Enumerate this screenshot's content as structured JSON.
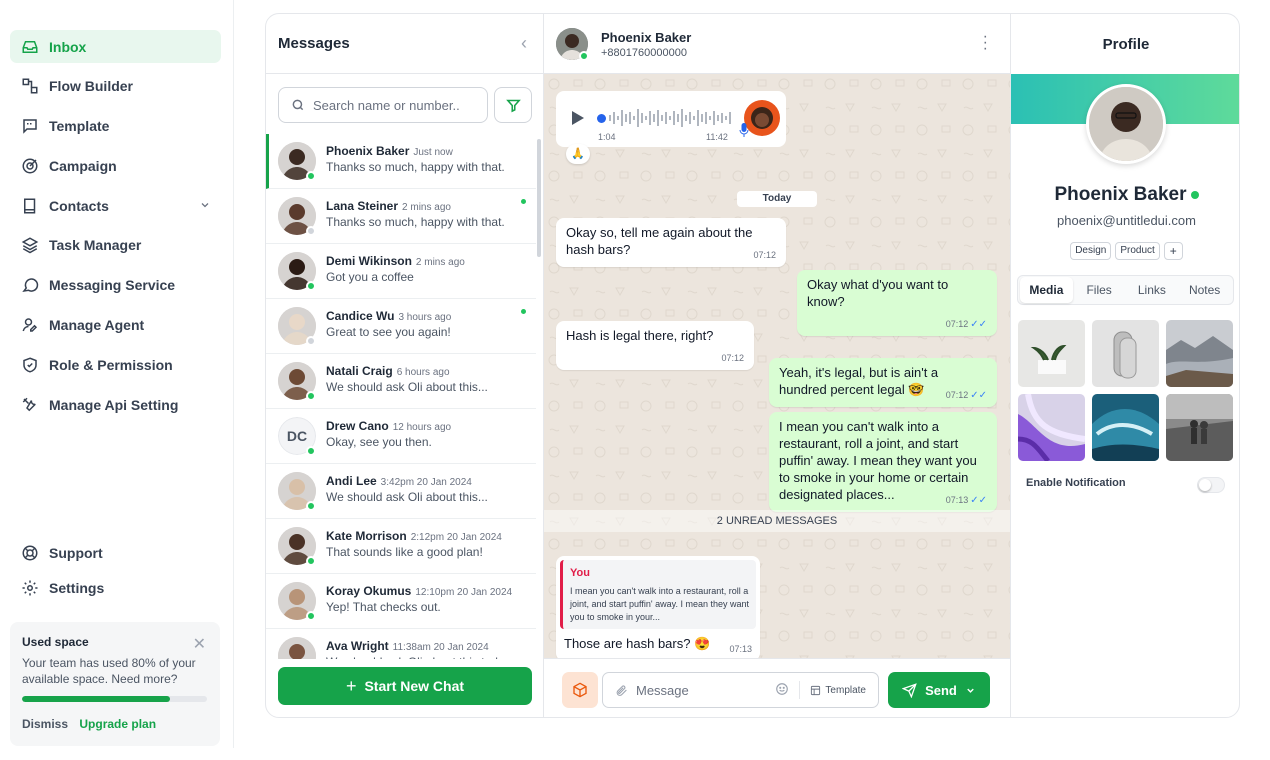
{
  "nav": {
    "items": [
      {
        "label": "Inbox",
        "icon": "inbox-icon",
        "active": true
      },
      {
        "label": "Flow Builder",
        "icon": "flow-builder-icon"
      },
      {
        "label": "Template",
        "icon": "template-icon"
      },
      {
        "label": "Campaign",
        "icon": "campaign-icon"
      },
      {
        "label": "Contacts",
        "icon": "contacts-icon"
      },
      {
        "label": "Task Manager",
        "icon": "task-manager-icon"
      },
      {
        "label": "Messaging Service",
        "icon": "messaging-service-icon"
      },
      {
        "label": "Manage Agent",
        "icon": "manage-agent-icon"
      },
      {
        "label": "Role & Permission",
        "icon": "shield-icon"
      },
      {
        "label": "Manage Api Setting",
        "icon": "tools-icon"
      }
    ],
    "bottom": [
      {
        "label": "Support",
        "icon": "lifebuoy-icon"
      },
      {
        "label": "Settings",
        "icon": "gear-icon"
      }
    ],
    "space": {
      "title": "Used space",
      "text": "Your team has used 80% of your available space. Need more?",
      "progress": 0.8,
      "dismiss": "Dismiss",
      "upgrade": "Upgrade plan"
    }
  },
  "list": {
    "title": "Messages",
    "search_placeholder": "Search name or number..",
    "new_chat": "Start New Chat",
    "contacts": [
      {
        "name": "Phoenix Baker",
        "time": "Just now",
        "preview": "Thanks so much, happy with that.",
        "online": true,
        "unread": false,
        "active": true,
        "skin": "#3b2a22"
      },
      {
        "name": "Lana Steiner",
        "time": "2 mins ago",
        "preview": "Thanks so much, happy with that.",
        "online": false,
        "unread": true,
        "skin": "#5a3a2c"
      },
      {
        "name": "Demi Wikinson",
        "time": "2 mins ago",
        "preview": "Got you a coffee",
        "online": true,
        "unread": false,
        "skin": "#2b1b14"
      },
      {
        "name": "Candice Wu",
        "time": "3 hours ago",
        "preview": "Great to see you again!",
        "online": false,
        "unread": true,
        "skin": "#e8d8c8"
      },
      {
        "name": "Natali Craig",
        "time": "6 hours ago",
        "preview": "We should ask Oli about this...",
        "online": true,
        "unread": false,
        "skin": "#6d4a35"
      },
      {
        "name": "Drew Cano",
        "time": "12 hours ago",
        "preview": "Okay, see you then.",
        "online": true,
        "unread": false,
        "initials": "DC"
      },
      {
        "name": "Andi Lee",
        "time": "3:42pm 20 Jan 2024",
        "preview": "We should ask Oli about this...",
        "online": true,
        "unread": false,
        "skin": "#d8c0a8"
      },
      {
        "name": "Kate Morrison",
        "time": "2:12pm 20 Jan 2024",
        "preview": "That sounds like a good plan!",
        "online": true,
        "unread": false,
        "skin": "#4a3226"
      },
      {
        "name": "Koray Okumus",
        "time": "12:10pm 20 Jan 2024",
        "preview": "Yep! That checks out.",
        "online": true,
        "unread": false,
        "skin": "#b89478"
      },
      {
        "name": "Ava Wright",
        "time": "11:38am 20 Jan 2024",
        "preview": "We should ask Oli about this today.",
        "online": true,
        "unread": false,
        "skin": "#7a5440"
      }
    ]
  },
  "chat": {
    "name": "Phoenix Baker",
    "phone": "+8801760000000",
    "audio": {
      "elapsed": "1:04",
      "sent": "11:42",
      "reaction": "🙏"
    },
    "day": "Today",
    "unread_label": "2 UNREAD MESSAGES",
    "messages": [
      {
        "dir": "in",
        "text": "Okay so, tell me again about the hash bars?",
        "time": "07:12"
      },
      {
        "dir": "out",
        "text": "Okay what d'you want to know?",
        "time": "07:12"
      },
      {
        "dir": "in",
        "text": "Hash is legal there, right?",
        "time": "07:12"
      },
      {
        "dir": "out",
        "text": "Yeah, it's legal, but is ain't a hundred percent legal 🤓",
        "time": "07:12"
      },
      {
        "dir": "out",
        "text": "I mean you can't walk into a restaurant, roll a joint, and start puffin' away. I mean they want you to smoke in your home or certain designated places...",
        "time": "07:13"
      }
    ],
    "reply": {
      "quote_author": "You",
      "quote_text": "I mean you can't walk into a restaurant, roll a joint, and start puffin' away. I mean they want you to smoke in your...",
      "text": "Those are hash bars? 😍",
      "time": "07:13"
    },
    "composer": {
      "placeholder": "Message",
      "template": "Template",
      "send": "Send"
    }
  },
  "profile": {
    "title": "Profile",
    "name": "Phoenix Baker",
    "email": "phoenix@untitledui.com",
    "tags": [
      "Design",
      "Product"
    ],
    "tag_add": "+",
    "tabs": [
      "Media",
      "Files",
      "Links",
      "Notes"
    ],
    "notification_label": "Enable Notification",
    "notification_on": false
  },
  "colors": {
    "accent": "#16a34a",
    "chat_bg": "#ece5dd",
    "out_bubble": "#d9fdd3"
  }
}
